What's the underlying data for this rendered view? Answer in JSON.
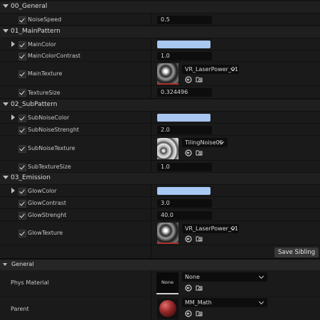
{
  "sections": {
    "general": "00_General",
    "main": "01_MainPattern",
    "sub": "02_SubPattern",
    "emission": "03_Emission"
  },
  "params": {
    "noise_speed": {
      "label": "NoiseSpeed",
      "value": "0.5"
    },
    "main_color": {
      "label": "MainColor",
      "color": "#a8c8f0"
    },
    "main_color_contrast": {
      "label": "MainColorContrast",
      "value": "1.0"
    },
    "main_texture": {
      "label": "MainTexture",
      "asset": "VR_LaserPower_01"
    },
    "texture_size": {
      "label": "TextureSize",
      "value": "0.324496"
    },
    "sub_noise_color": {
      "label": "SubNoiseColor",
      "color": "#a8c4f0"
    },
    "sub_noise_strength": {
      "label": "SubNoiseStrenght",
      "value": "2.0"
    },
    "sub_noise_texture": {
      "label": "SubNoiseTexture",
      "asset": "TilingNoise05"
    },
    "sub_texture_size": {
      "label": "SubTextureSize",
      "value": "1.0"
    },
    "glow_color": {
      "label": "GlowColor",
      "color": "#a8c8f4"
    },
    "glow_contrast": {
      "label": "GlowContrast",
      "value": "3.0"
    },
    "glow_strength": {
      "label": "GlowStrenght",
      "value": "40.0"
    },
    "glow_texture": {
      "label": "GlowTexture",
      "asset": "VR_LaserPower_01"
    }
  },
  "save_sibling": "Save Sibling",
  "general_category": {
    "title": "General",
    "phys_material": {
      "label": "Phys Material",
      "thumb_text": "None",
      "value": "None"
    },
    "parent": {
      "label": "Parent",
      "value": "MM_Math"
    }
  },
  "icons": {
    "use_asset": "arrow-left-circle-icon",
    "browse_asset": "folder-search-icon",
    "expand": "triangle-right-icon",
    "collapse": "triangle-down-icon",
    "checkbox": "checkmark-icon"
  }
}
